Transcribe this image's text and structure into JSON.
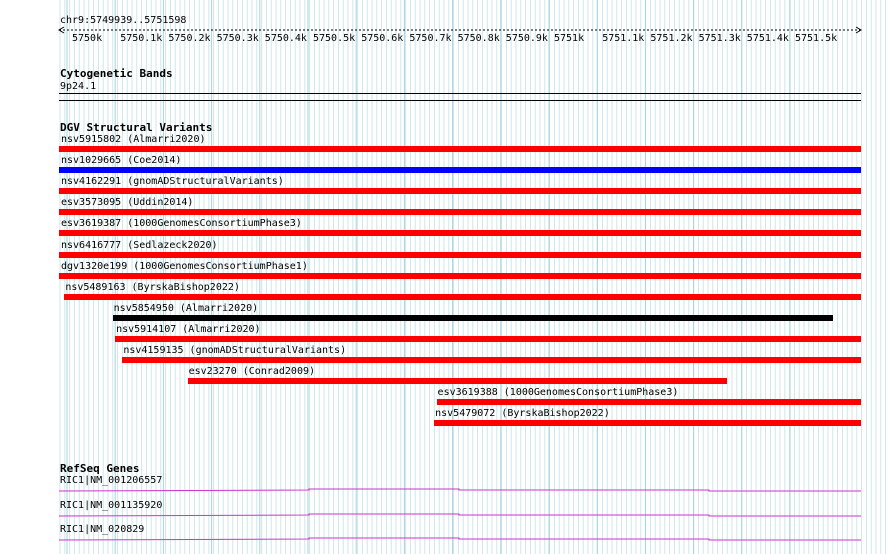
{
  "locus": "chr9:5749939..5751598",
  "scale": {
    "ticks": [
      "5750k",
      "5750.1k",
      "5750.2k",
      "5750.3k",
      "5750.4k",
      "5750.5k",
      "5750.6k",
      "5750.7k",
      "5750.8k",
      "5750.9k",
      "5751k",
      "5751.1k",
      "5751.2k",
      "5751.3k",
      "5751.4k",
      "5751.5k"
    ],
    "range_bp": [
      5749939,
      5751598
    ]
  },
  "cytogenetic": {
    "title": "Cytogenetic Bands",
    "band": "9p24.1"
  },
  "dgv": {
    "title": "DGV Structural Variants",
    "features": [
      {
        "label": "nsv5915802 (Almarri2020)",
        "color": "#ff0000",
        "start": 5749939,
        "end": 5751598
      },
      {
        "label": "nsv1029665 (Coe2014)",
        "color": "#0000ff",
        "start": 5749939,
        "end": 5751598
      },
      {
        "label": "nsv4162291 (gnomADStructuralVariants)",
        "color": "#ff0000",
        "start": 5749939,
        "end": 5751598
      },
      {
        "label": "esv3573095 (Uddin2014)",
        "color": "#ff0000",
        "start": 5749939,
        "end": 5751598
      },
      {
        "label": "esv3619387 (1000GenomesConsortiumPhase3)",
        "color": "#ff0000",
        "start": 5749939,
        "end": 5751598
      },
      {
        "label": "nsv6416777 (Sedlazeck2020)",
        "color": "#ff0000",
        "start": 5749939,
        "end": 5751598
      },
      {
        "label": "dgv1320e199 (1000GenomesConsortiumPhase1)",
        "color": "#ff0000",
        "start": 5749939,
        "end": 5751598
      },
      {
        "label": "nsv5489163 (ByrskaBishop2022)",
        "color": "#ff0000",
        "start": 5749950,
        "end": 5751598
      },
      {
        "label": "nsv5854950 (Almarri2020)",
        "color": "#000000",
        "start": 5750050,
        "end": 5751540
      },
      {
        "label": "nsv5914107 (Almarri2020)",
        "color": "#ff0000",
        "start": 5750055,
        "end": 5751598
      },
      {
        "label": "nsv4159135 (gnomADStructuralVariants)",
        "color": "#ff0000",
        "start": 5750070,
        "end": 5751598
      },
      {
        "label": "esv23270 (Conrad2009)",
        "color": "#ff0000",
        "start": 5750205,
        "end": 5751320
      },
      {
        "label": "esv3619388 (1000GenomesConsortiumPhase3)",
        "color": "#ff0000",
        "start": 5750720,
        "end": 5751598
      },
      {
        "label": "nsv5479072 (ByrskaBishop2022)",
        "color": "#ff0000",
        "start": 5750715,
        "end": 5751598
      }
    ]
  },
  "refseq": {
    "title": "RefSeq Genes",
    "genes": [
      {
        "label": "RIC1|NM_001206557",
        "color": "#cc33cc"
      },
      {
        "label": "RIC1|NM_001135920",
        "color": "#cc33cc"
      },
      {
        "label": "RIC1|NM_020829",
        "color": "#cc33cc"
      }
    ]
  }
}
